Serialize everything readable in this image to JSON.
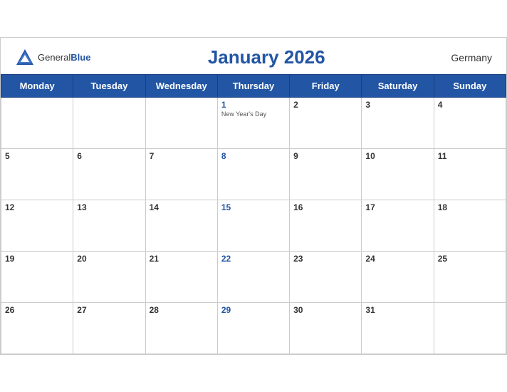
{
  "header": {
    "logo_general": "General",
    "logo_blue": "Blue",
    "title": "January 2026",
    "country": "Germany"
  },
  "weekdays": [
    "Monday",
    "Tuesday",
    "Wednesday",
    "Thursday",
    "Friday",
    "Saturday",
    "Sunday"
  ],
  "weeks": [
    [
      {
        "day": "",
        "empty": true
      },
      {
        "day": "",
        "empty": true
      },
      {
        "day": "",
        "empty": true
      },
      {
        "day": "1",
        "holiday": "New Year's Day",
        "thursday": true
      },
      {
        "day": "2"
      },
      {
        "day": "3"
      },
      {
        "day": "4"
      }
    ],
    [
      {
        "day": "5"
      },
      {
        "day": "6"
      },
      {
        "day": "7"
      },
      {
        "day": "8",
        "thursday": true
      },
      {
        "day": "9"
      },
      {
        "day": "10"
      },
      {
        "day": "11"
      }
    ],
    [
      {
        "day": "12"
      },
      {
        "day": "13"
      },
      {
        "day": "14"
      },
      {
        "day": "15",
        "thursday": true
      },
      {
        "day": "16"
      },
      {
        "day": "17"
      },
      {
        "day": "18"
      }
    ],
    [
      {
        "day": "19"
      },
      {
        "day": "20"
      },
      {
        "day": "21"
      },
      {
        "day": "22",
        "thursday": true
      },
      {
        "day": "23"
      },
      {
        "day": "24"
      },
      {
        "day": "25"
      }
    ],
    [
      {
        "day": "26"
      },
      {
        "day": "27"
      },
      {
        "day": "28"
      },
      {
        "day": "29",
        "thursday": true
      },
      {
        "day": "30"
      },
      {
        "day": "31"
      },
      {
        "day": "",
        "empty": true
      }
    ]
  ]
}
